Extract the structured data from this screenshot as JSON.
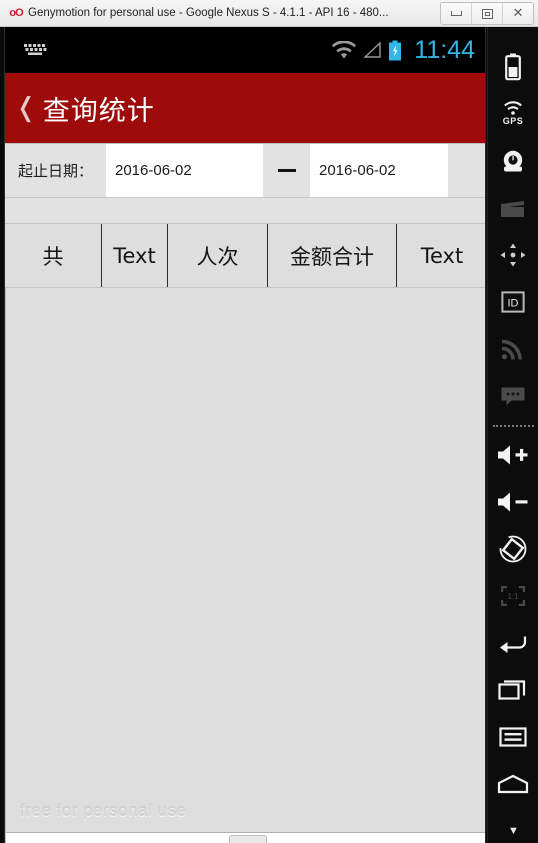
{
  "window": {
    "title": "Genymotion for personal use - Google Nexus S - 4.1.1 - API 16 - 480...",
    "app_icon": "genymotion-icon",
    "buttons": {
      "minimize": "minimize-button",
      "maximize": "maximize-button",
      "close": "close-button",
      "close_glyph": "✕"
    }
  },
  "status_bar": {
    "keyboard_icon": "keyboard-icon",
    "wifi_icon": "wifi-icon",
    "signal_icon": "signal-icon",
    "battery_icon": "battery-charging-icon",
    "clock": "11:44"
  },
  "action_bar": {
    "back_glyph": "❬",
    "title": "查询统计"
  },
  "filter": {
    "label": "起止日期：",
    "start_date": "2016-06-02",
    "separator": "—",
    "end_date": "2016-06-02"
  },
  "summary": {
    "cells": [
      {
        "label": "共"
      },
      {
        "label": "Text"
      },
      {
        "label": "人次"
      },
      {
        "label": "金额合计"
      },
      {
        "label": "Text"
      }
    ]
  },
  "content": {
    "watermark": "free for personal use"
  },
  "toolbar": {
    "items": [
      {
        "name": "battery-icon",
        "label": "Battery",
        "dim": false
      },
      {
        "name": "gps-icon",
        "label": "GPS",
        "dim": false
      },
      {
        "name": "camera-icon",
        "label": "Camera",
        "dim": false
      },
      {
        "name": "video-icon",
        "label": "Video",
        "dim": true
      },
      {
        "name": "accelerometer-icon",
        "label": "Accelerometer",
        "dim": false
      },
      {
        "name": "identifiers-icon",
        "label": "ID",
        "dim": false
      },
      {
        "name": "network-icon",
        "label": "Network",
        "dim": true
      },
      {
        "name": "sms-icon",
        "label": "SMS",
        "dim": true
      }
    ],
    "items2": [
      {
        "name": "volume-up-icon",
        "label": "Volume up",
        "dim": false
      },
      {
        "name": "volume-down-icon",
        "label": "Volume down",
        "dim": false
      },
      {
        "name": "rotate-icon",
        "label": "Rotate",
        "dim": false
      },
      {
        "name": "fullscreen-icon",
        "label": "1:1",
        "dim": true
      },
      {
        "name": "back-icon",
        "label": "Back",
        "dim": false
      },
      {
        "name": "recents-icon",
        "label": "Recents",
        "dim": false
      },
      {
        "name": "menu-icon",
        "label": "Menu",
        "dim": false
      },
      {
        "name": "home-icon",
        "label": "Home",
        "dim": false
      }
    ],
    "more_glyph": "▼",
    "gps_text": "GPS",
    "id_text": "ID"
  },
  "colors": {
    "action_bar": "#9e0b0b",
    "clock": "#33b5e5",
    "screen_bg": "#dedede",
    "toolbar_bg": "#0c0c0c"
  }
}
